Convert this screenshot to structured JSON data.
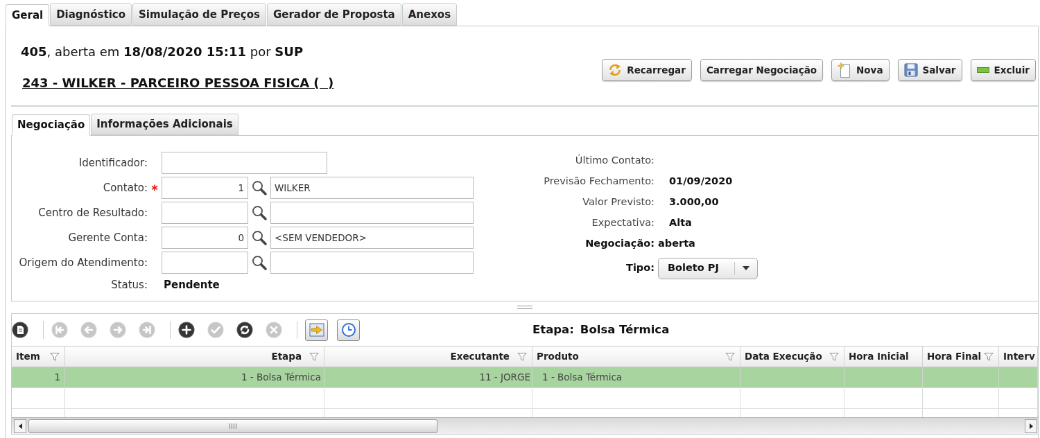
{
  "tabs": [
    {
      "label": "Geral",
      "selected": true
    },
    {
      "label": "Diagnóstico",
      "selected": false
    },
    {
      "label": "Simulação de Preços",
      "selected": false
    },
    {
      "label": "Gerador de Proposta",
      "selected": false
    },
    {
      "label": "Anexos",
      "selected": false
    }
  ],
  "header": {
    "summary": "**405**, aberta em **18/08/2020 15:11** por **SUP**",
    "title": "243 - WILKER - PARCEIRO PESSOA FISICA (  )"
  },
  "actions": [
    {
      "label": "Recarregar",
      "kind": "reload"
    },
    {
      "label": "Carregar Negociação",
      "kind": "plain"
    },
    {
      "label": "Nova",
      "kind": "new"
    },
    {
      "label": "Salvar",
      "kind": "save"
    },
    {
      "label": "Excluir",
      "kind": "remove"
    }
  ],
  "subtabs": [
    {
      "label": "Negociação",
      "selected": true
    },
    {
      "label": "Informações Adicionais",
      "selected": false
    }
  ],
  "form": {
    "left": [
      {
        "label": "Identificador:",
        "kind": "text",
        "required": false
      },
      {
        "label": "Contato:",
        "kind": "lookup",
        "required": true,
        "code": "1",
        "description": "WILKER"
      },
      {
        "label": "Centro de Resultado:",
        "kind": "lookup",
        "required": false
      },
      {
        "label": "Gerente Conta:",
        "kind": "lookup",
        "required": false,
        "code": "0",
        "description": "<SEM VENDEDOR>"
      },
      {
        "label": "Origem do Atendimento:",
        "kind": "lookup",
        "required": false
      },
      {
        "label": "Status:",
        "kind": "value",
        "required": false,
        "value": "Pendente"
      }
    ],
    "right": [
      {
        "label": "Último Contato:",
        "kind": "info"
      },
      {
        "label": "Previsão Fechamento:",
        "kind": "info",
        "value": "01/09/2020"
      },
      {
        "label": "Valor Previsto:",
        "kind": "info",
        "value": "3.000,00"
      },
      {
        "label": "Expectativa:",
        "kind": "info",
        "value": "Alta"
      },
      {
        "label": "Negociação:",
        "kind": "status",
        "value": "aberta"
      },
      {
        "label": "Tipo:",
        "kind": "select",
        "value": "Boleto PJ"
      }
    ]
  },
  "grid": {
    "toolbar": [
      [
        {
          "kind": "document",
          "disabled": false
        }
      ],
      [
        {
          "kind": "first",
          "disabled": true
        },
        {
          "kind": "previous",
          "disabled": true
        },
        {
          "kind": "next",
          "disabled": true
        },
        {
          "kind": "last",
          "disabled": true
        }
      ],
      [
        {
          "kind": "add",
          "disabled": false
        },
        {
          "kind": "confirm",
          "disabled": true
        },
        {
          "kind": "refresh",
          "disabled": false
        },
        {
          "kind": "cancel",
          "disabled": true
        }
      ],
      [
        {
          "kind": "export",
          "disabled": false
        },
        {
          "kind": "schedule",
          "disabled": false
        }
      ]
    ],
    "stage": {
      "label": "Etapa:",
      "value": "Bolsa Térmica"
    },
    "columns": [
      {
        "label": "Item",
        "filter": true
      },
      {
        "label": "Etapa",
        "filter": true
      },
      {
        "label": "Executante",
        "filter": true
      },
      {
        "label": "Produto",
        "filter": true
      },
      {
        "label": "Data Execução",
        "filter": true
      },
      {
        "label": "Hora Inicial",
        "filter": false
      },
      {
        "label": "Hora Final",
        "filter": true
      },
      {
        "label": "Interv",
        "filter": false
      }
    ],
    "rows": [
      {
        "cells": [
          "1",
          "1 - Bolsa Térmica",
          "11 - JORGE",
          "1 - Bolsa Térmica"
        ],
        "selected": true
      }
    ]
  }
}
